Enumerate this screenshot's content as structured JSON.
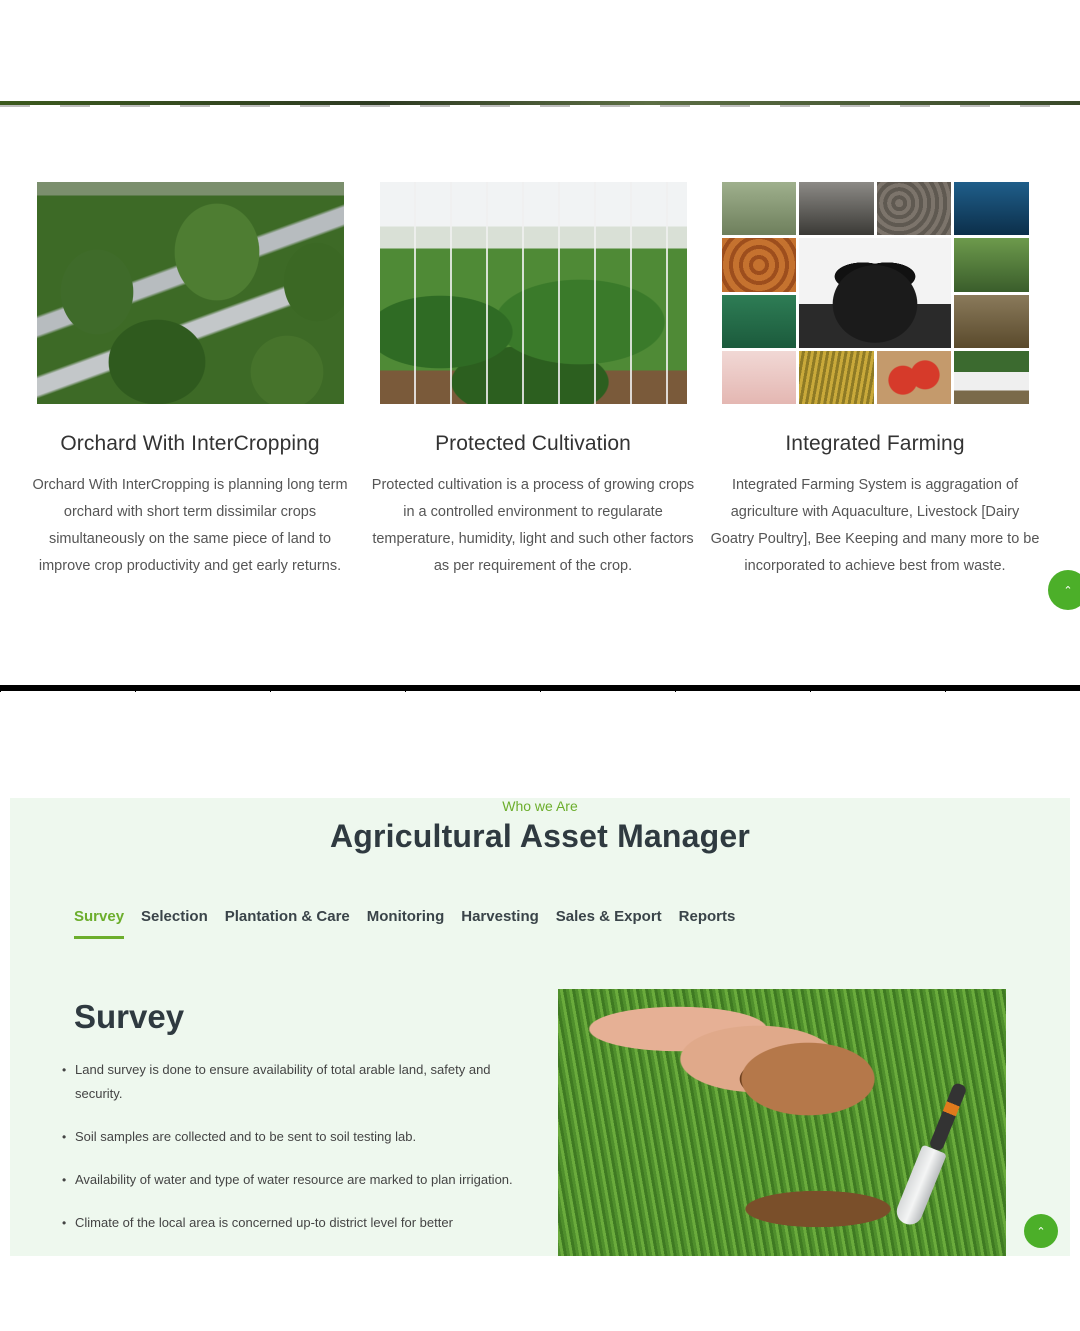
{
  "top_section": {
    "cards": [
      {
        "image": "orchard-field-photo",
        "title": "Orchard With InterCropping",
        "description": "Orchard With InterCropping is planning long term orchard with short term dissimilar crops simultaneously on the same piece of land to improve crop productivity and get early returns."
      },
      {
        "image": "greenhouse-photo",
        "title": "Protected Cultivation",
        "description": "Protected cultivation is a process of growing crops in a controlled environment to regularate temperature, humidity, light and such other factors as per requirement of the crop."
      },
      {
        "image": "integrated-farming-collage",
        "title": "Integrated Farming",
        "description": "Integrated Farming System is aggragation of agriculture with Aquaculture, Livestock [Dairy Goatry Poultry], Bee Keeping and many more to be incorporated to achieve best from waste."
      }
    ],
    "scroll_top_icon": "chevron-up-icon"
  },
  "about_section": {
    "eyebrow": "Who we Are",
    "title": "Agricultural Asset Manager",
    "tabs": [
      {
        "label": "Survey",
        "active": true
      },
      {
        "label": "Selection",
        "active": false
      },
      {
        "label": "Plantation & Care",
        "active": false
      },
      {
        "label": "Monitoring",
        "active": false
      },
      {
        "label": "Harvesting",
        "active": false
      },
      {
        "label": "Sales & Export",
        "active": false
      },
      {
        "label": "Reports",
        "active": false
      }
    ],
    "content_title": "Survey",
    "bullets": [
      "Land survey is done to ensure availability of total arable land, safety and security.",
      "Soil samples are collected and to be sent to soil testing lab.",
      "Availability of water and type of water resource are marked to plan irrigation.",
      "Climate of the local area is concerned up-to district level for better"
    ],
    "photo": "hand-holding-soil-photo",
    "scroll_top_icon": "chevron-up-icon"
  },
  "colors": {
    "accent": "#6cae2c",
    "fab": "#4caf29",
    "panel_bg": "#eef8ee",
    "heading": "#2f3a40"
  }
}
